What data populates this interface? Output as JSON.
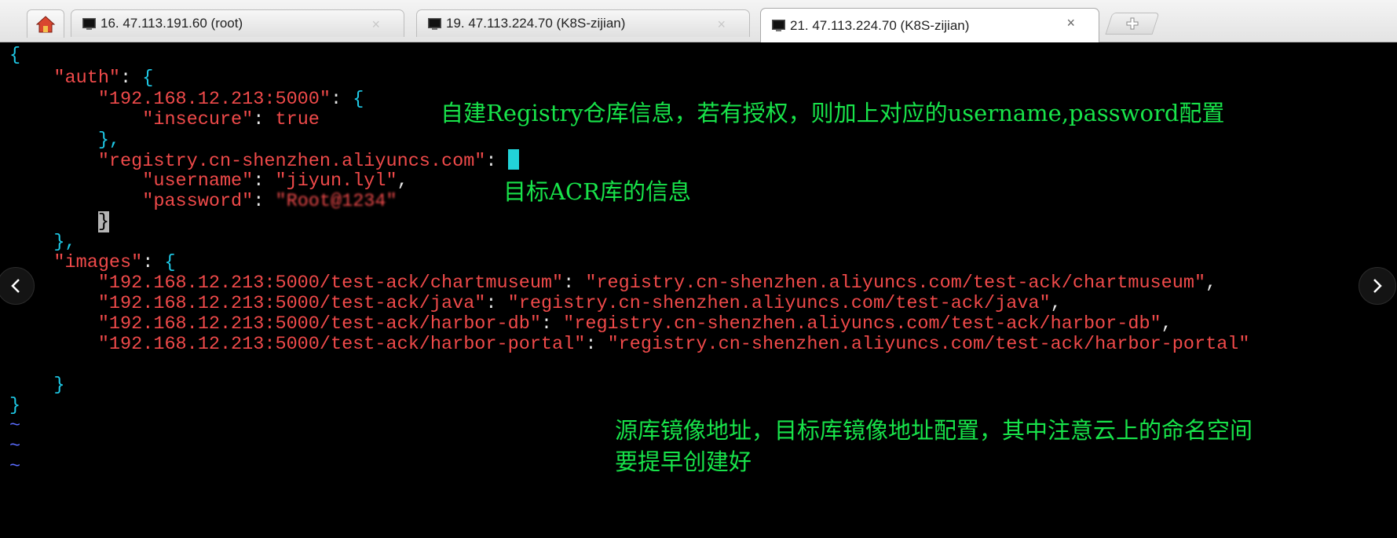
{
  "tabs": [
    {
      "title": "16. 47.113.191.60 (root)",
      "active": false
    },
    {
      "title": "19. 47.113.224.70 (K8S-zijian)",
      "active": false
    },
    {
      "title": "21. 47.113.224.70 (K8S-zijian)",
      "active": true
    }
  ],
  "tab_close_glyph": "×",
  "icons": {
    "home": "home-icon",
    "terminal": "terminal-icon",
    "new_tab": "new-tab-icon",
    "prev": "chevron-left-icon",
    "next": "chevron-right-icon"
  },
  "code": {
    "open_brace": "{",
    "auth_key": "\"auth\"",
    "registry1_key": "\"192.168.12.213:5000\"",
    "insecure_key": "\"insecure\"",
    "insecure_val": "true",
    "close_inner": "},",
    "registry2_key": "\"registry.cn-shenzhen.aliyuncs.com\"",
    "username_key": "\"username\"",
    "username_val": "\"jiyun.lyl\"",
    "password_key": "\"password\"",
    "password_val": "\"Root@1234\"",
    "cursor_char": "}",
    "close_auth": "},",
    "images_key": "\"images\"",
    "images": [
      {
        "src": "\"192.168.12.213:5000/test-ack/chartmuseum\"",
        "dst": "\"registry.cn-shenzhen.aliyuncs.com/test-ack/chartmuseum\"",
        "sep": ","
      },
      {
        "src": "\"192.168.12.213:5000/test-ack/java\"",
        "dst": "\"registry.cn-shenzhen.aliyuncs.com/test-ack/java\"",
        "sep": ","
      },
      {
        "src": "\"192.168.12.213:5000/test-ack/harbor-db\"",
        "dst": "\"registry.cn-shenzhen.aliyuncs.com/test-ack/harbor-db\"",
        "sep": ","
      },
      {
        "src": "\"192.168.12.213:5000/test-ack/harbor-portal\"",
        "dst": "\"registry.cn-shenzhen.aliyuncs.com/test-ack/harbor-portal\"",
        "sep": ""
      }
    ],
    "close_images": "}",
    "close_root": "}",
    "tilde": "~"
  },
  "annotations": {
    "registry_note": "自建Registry仓库信息，若有授权，则加上对应的username,password配置",
    "acr_note": "目标ACR库的信息",
    "images_note_line1": "源库镜像地址，目标库镜像地址配置，其中注意云上的命名空间",
    "images_note_line2": "要提早创建好"
  },
  "colors": {
    "key": "#f04a4a",
    "brace": "#1ec9e6",
    "annotation": "#18e34a",
    "tilde": "#5a6cff"
  }
}
